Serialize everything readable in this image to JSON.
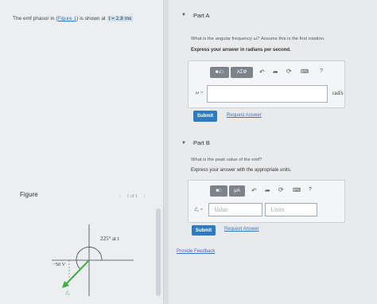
{
  "intro": {
    "prefix": "The emf phasor in",
    "figure_link": "Figure 1",
    "suffix": "is shown at",
    "time": "t = 2.8 ms"
  },
  "figure": {
    "label": "Figure",
    "pager": "1 of 1",
    "angle_label": "225° at t",
    "voltage_label": "−50 V",
    "phasor_label": "ℰ₀"
  },
  "partA": {
    "title": "Part A",
    "question": "What is the angular frequency ω? Assume this is the first rotation.",
    "instruction": "Express your answer in radians per second.",
    "symbol_button": "AΣΦ",
    "help": "?",
    "input_label": "ω =",
    "unit": "rad/s",
    "submit": "Submit",
    "request": "Request Answer"
  },
  "partB": {
    "title": "Part B",
    "question": "What is the peak value of the emf?",
    "instruction": "Express your answer with the appropriate units.",
    "unit_button": "μA",
    "help": "?",
    "input_label": "ℰ₀ =",
    "value_placeholder": "Value",
    "units_placeholder": "Units",
    "submit": "Submit",
    "request": "Request Answer"
  },
  "feedback": "Provide Feedback",
  "colors": {
    "accent": "#2d7cc1",
    "phasor": "#3cb043",
    "toolbar": "#7c838a"
  }
}
